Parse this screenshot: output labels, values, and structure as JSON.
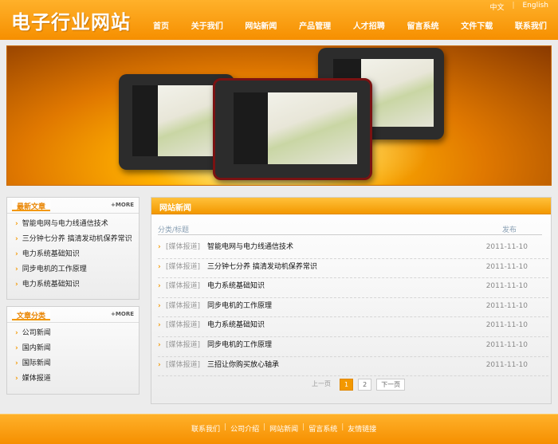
{
  "header": {
    "logo": "电子行业网站",
    "lang": [
      "中文",
      "English"
    ],
    "nav": [
      "首页",
      "关于我们",
      "网站新闻",
      "产品管理",
      "人才招聘",
      "留言系统",
      "文件下载",
      "联系我们"
    ]
  },
  "sidebar": {
    "latest": {
      "title": "最新文章",
      "more": "+MORE",
      "items": [
        "智能电网与电力线通信技术",
        "三分钟七分养 搞清发动机保养常识",
        "电力系统基础知识",
        "同步电机的工作原理",
        "电力系统基础知识"
      ]
    },
    "categories": {
      "title": "文章分类",
      "more": "+MORE",
      "items": [
        "公司新闻",
        "国内新闻",
        "国际新闻",
        "媒体报道"
      ]
    }
  },
  "main": {
    "title": "网站新闻",
    "col_title": "分类/标题",
    "col_date": "发布",
    "rows": [
      {
        "cat": "[媒体报道]",
        "title": "智能电网与电力线通信技术",
        "date": "2011-11-10"
      },
      {
        "cat": "[媒体报道]",
        "title": "三分钟七分养 搞清发动机保养常识",
        "date": "2011-11-10"
      },
      {
        "cat": "[媒体报道]",
        "title": "电力系统基础知识",
        "date": "2011-11-10"
      },
      {
        "cat": "[媒体报道]",
        "title": "同步电机的工作原理",
        "date": "2011-11-10"
      },
      {
        "cat": "[媒体报道]",
        "title": "电力系统基础知识",
        "date": "2011-11-10"
      },
      {
        "cat": "[媒体报道]",
        "title": "同步电机的工作原理",
        "date": "2011-11-10"
      },
      {
        "cat": "[媒体报道]",
        "title": "三招让你购买放心轴承",
        "date": "2011-11-10"
      }
    ],
    "pager": {
      "prev": "上一页",
      "pages": [
        "1",
        "2"
      ],
      "next": "下一页"
    }
  },
  "footer": {
    "links": [
      "联系我们",
      "公司介绍",
      "网站新闻",
      "留言系统",
      "友情链接"
    ]
  },
  "colors": {
    "accent": "#f39800",
    "header": "#f68f00"
  }
}
